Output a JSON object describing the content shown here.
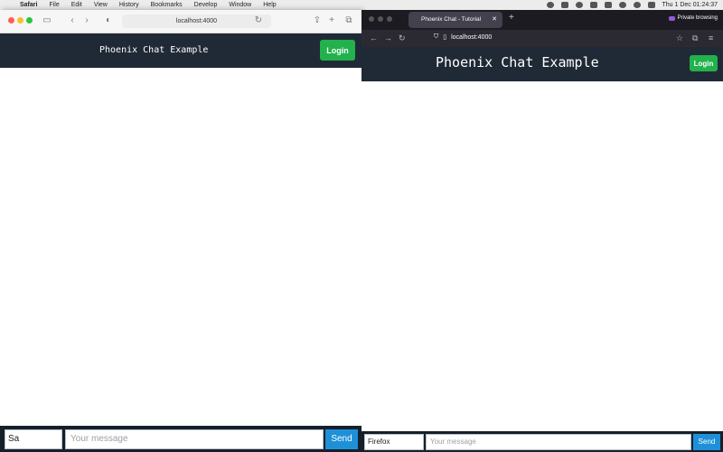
{
  "menubar": {
    "app_name": "Safari",
    "items": [
      "File",
      "Edit",
      "View",
      "History",
      "Bookmarks",
      "Develop",
      "Window",
      "Help"
    ],
    "clock": "Thu 1 Dec  01:24:37"
  },
  "safari": {
    "address": "localhost:4000",
    "app": {
      "title": "Phoenix Chat Example",
      "login_label": "Login",
      "name_value": "Sa",
      "message_placeholder": "Your message",
      "send_label": "Send"
    }
  },
  "firefox": {
    "tab_title": "Phoenix Chat - Tutorial",
    "private_label": "Private browsing",
    "url": "localhost:4000",
    "app": {
      "title": "Phoenix Chat Example",
      "login_label": "Login",
      "name_value": "Firefox",
      "message_placeholder": "Your message",
      "send_label": "Send"
    }
  },
  "colors": {
    "header_bg": "#202a36",
    "login_green": "#22b14c",
    "send_blue": "#1e90d8"
  }
}
